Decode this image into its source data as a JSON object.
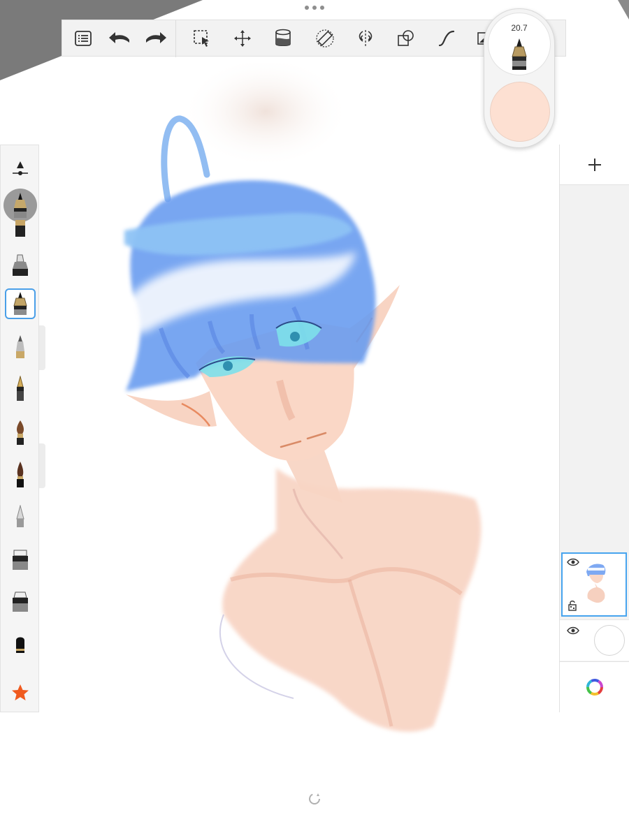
{
  "app": {
    "more_menu": "more-dots",
    "brush_size_value": "20.7",
    "current_color": "#fde0d2",
    "accent_color": "#4a9fe8"
  },
  "toolbar": {
    "tools": [
      {
        "name": "list-icon"
      },
      {
        "name": "undo-icon"
      },
      {
        "name": "redo-icon"
      },
      {
        "name": "selection-icon"
      },
      {
        "name": "transform-icon"
      },
      {
        "name": "fill-icon"
      },
      {
        "name": "ruler-icon"
      },
      {
        "name": "symmetry-icon"
      },
      {
        "name": "shapes-icon"
      },
      {
        "name": "curve-icon"
      }
    ]
  },
  "brushes": {
    "selected_index": 2,
    "items": [
      {
        "name": "pencil-brush-icon"
      },
      {
        "name": "marker-brush-icon"
      },
      {
        "name": "inking-pen-icon"
      },
      {
        "name": "ballpoint-pen-icon"
      },
      {
        "name": "fountain-pen-icon"
      },
      {
        "name": "paint-brush-icon"
      },
      {
        "name": "airbrush-icon"
      },
      {
        "name": "smudge-icon"
      },
      {
        "name": "eraser-block-icon"
      },
      {
        "name": "eraser-soft-icon"
      },
      {
        "name": "chisel-marker-icon"
      },
      {
        "name": "favorites-star-icon"
      }
    ]
  },
  "layers": {
    "items": [
      {
        "name": "drawing-layer",
        "visible": true,
        "locked": false
      },
      {
        "name": "background-layer",
        "visible": true
      }
    ]
  }
}
